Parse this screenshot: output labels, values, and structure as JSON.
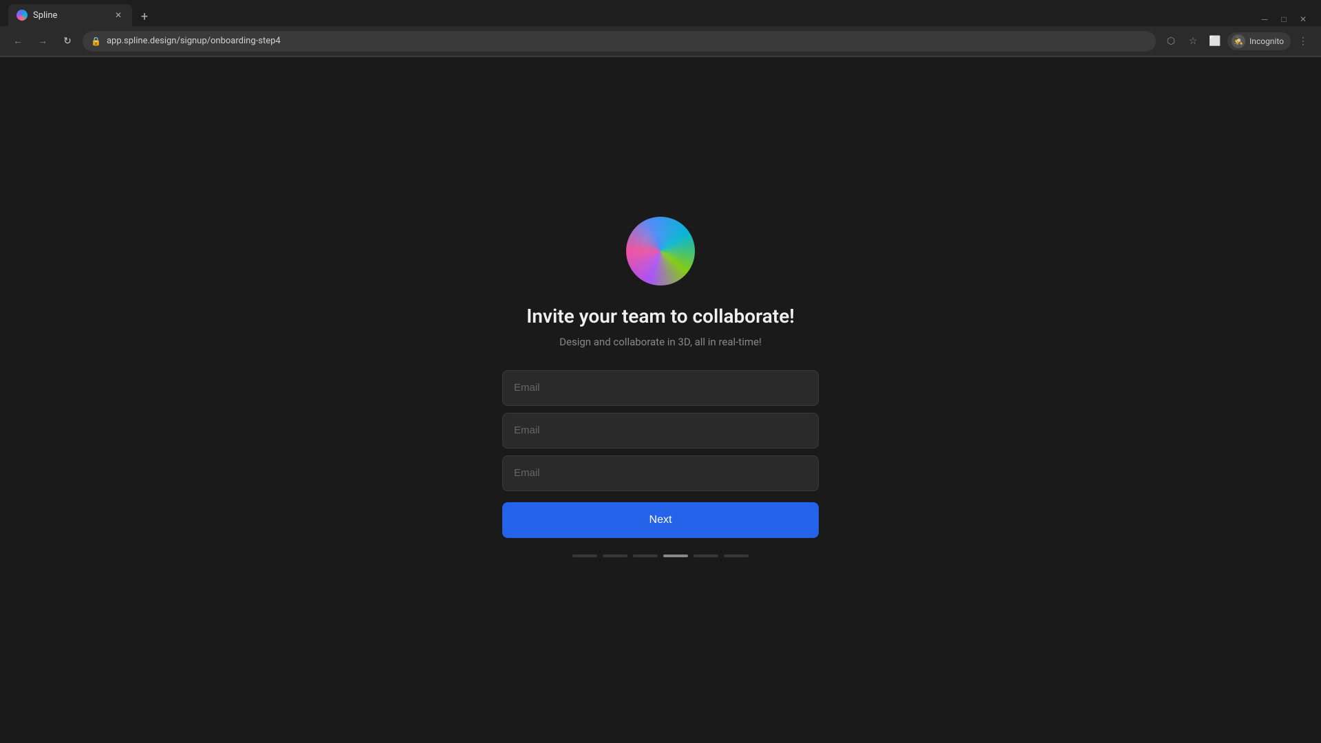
{
  "browser": {
    "tab": {
      "title": "Spline",
      "favicon": "spline-favicon"
    },
    "url": "app.spline.design/signup/onboarding-step4",
    "incognito_label": "Incognito",
    "new_tab_label": "+"
  },
  "toolbar": {
    "back_label": "←",
    "forward_label": "→",
    "refresh_label": "↻"
  },
  "page": {
    "title": "Invite your team to collaborate!",
    "subtitle": "Design and collaborate in 3D, all in real-time!",
    "email_placeholder": "Email",
    "next_button_label": "Next",
    "step_count": 6,
    "active_step": 4
  }
}
